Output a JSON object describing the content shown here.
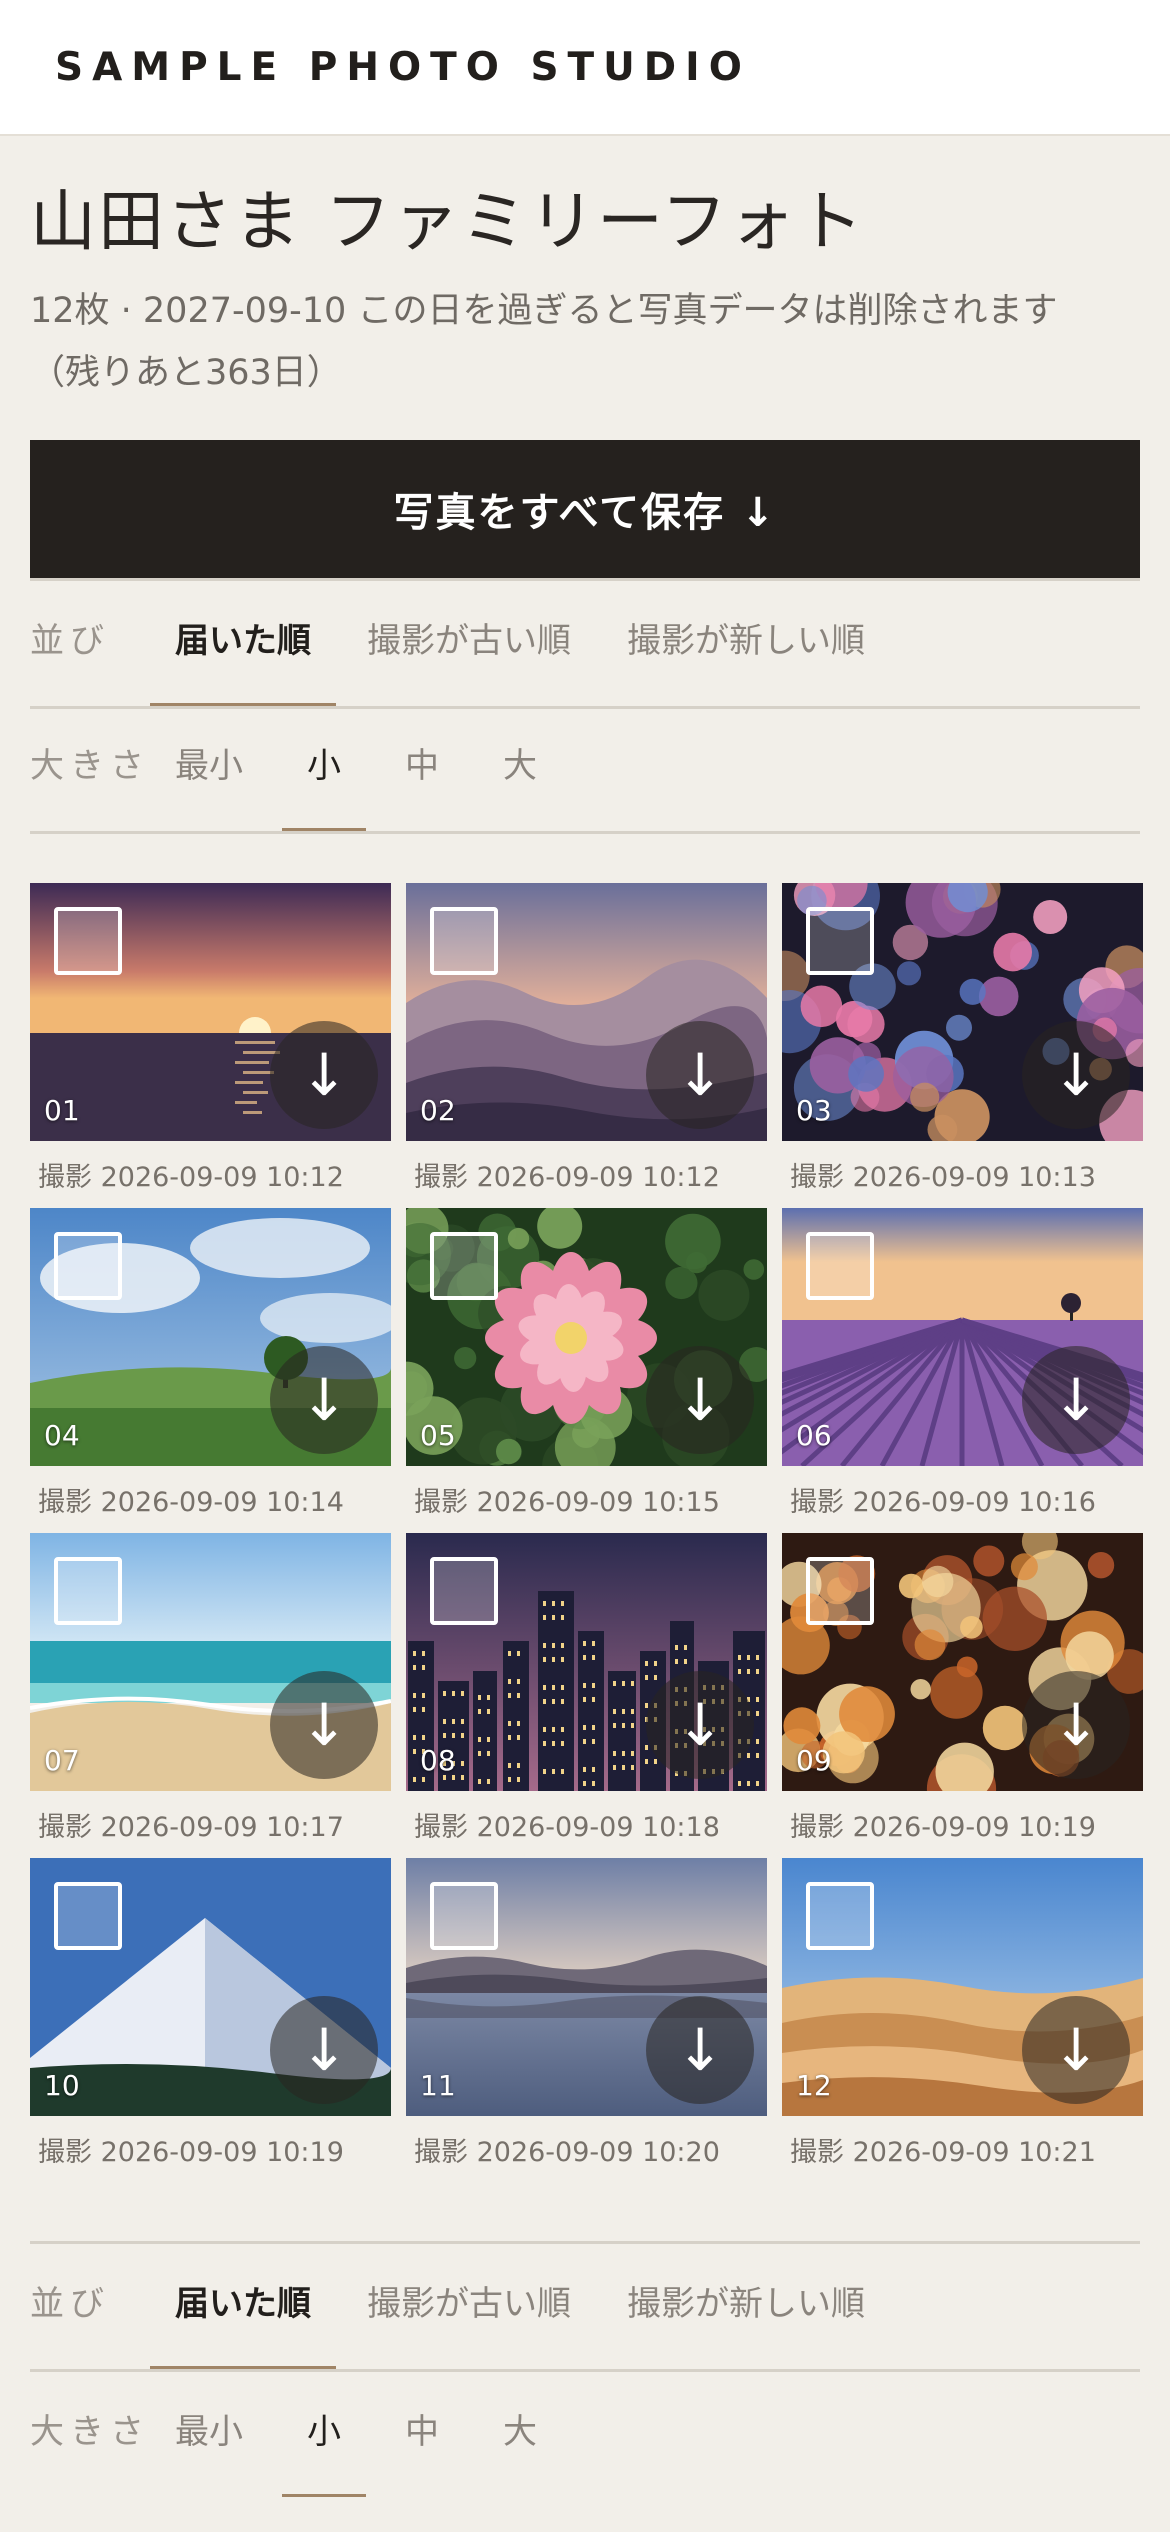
{
  "header": {
    "logo": "SAMPLE PHOTO STUDIO"
  },
  "album": {
    "title": "山田さま ファミリーフォト",
    "meta_line1": "12枚 · 2027-09-10 この日を過ぎると写真データは削除されます",
    "meta_line2": "（残りあと363日）"
  },
  "save_button": {
    "label": "写真をすべて保存 ↓"
  },
  "sort": {
    "label": "並び",
    "options": [
      "届いた順",
      "撮影が古い順",
      "撮影が新しい順"
    ],
    "active": "届いた順"
  },
  "size": {
    "label": "大きさ",
    "options": [
      "最小",
      "小",
      "中",
      "大"
    ],
    "active": "小"
  },
  "download_icon": "↓",
  "photos": [
    {
      "num": "01",
      "caption": "撮影 2026-09-09 10:12",
      "scene": "sunset-sea"
    },
    {
      "num": "02",
      "caption": "撮影 2026-09-09 10:12",
      "scene": "mountains"
    },
    {
      "num": "03",
      "caption": "撮影 2026-09-09 10:13",
      "scene": "bokeh-color"
    },
    {
      "num": "04",
      "caption": "撮影 2026-09-09 10:14",
      "scene": "meadow"
    },
    {
      "num": "05",
      "caption": "撮影 2026-09-09 10:15",
      "scene": "flower"
    },
    {
      "num": "06",
      "caption": "撮影 2026-09-09 10:16",
      "scene": "lavender"
    },
    {
      "num": "07",
      "caption": "撮影 2026-09-09 10:17",
      "scene": "beach"
    },
    {
      "num": "08",
      "caption": "撮影 2026-09-09 10:18",
      "scene": "city"
    },
    {
      "num": "09",
      "caption": "撮影 2026-09-09 10:19",
      "scene": "bokeh-warm"
    },
    {
      "num": "10",
      "caption": "撮影 2026-09-09 10:19",
      "scene": "snow-peak"
    },
    {
      "num": "11",
      "caption": "撮影 2026-09-09 10:20",
      "scene": "lake"
    },
    {
      "num": "12",
      "caption": "撮影 2026-09-09 10:21",
      "scene": "desert"
    }
  ]
}
